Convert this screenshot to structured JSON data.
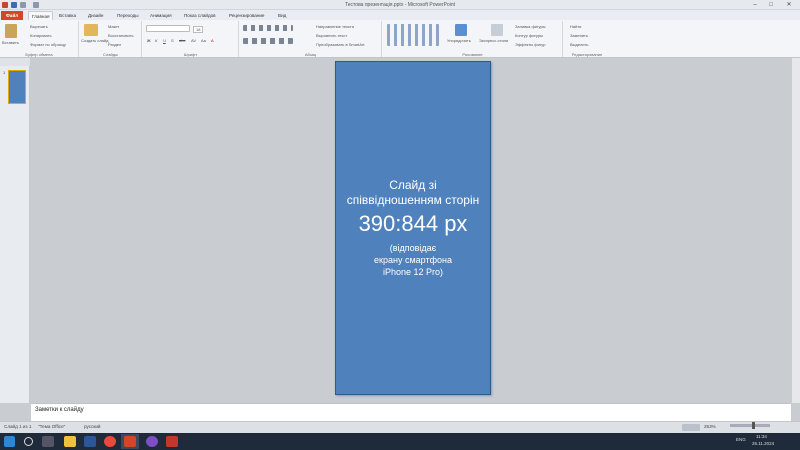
{
  "window": {
    "title": "Тестова презентація.pptx - Microsoft PowerPoint",
    "minimize": "–",
    "maximize": "□",
    "close": "✕"
  },
  "tabs": [
    "Файл",
    "Главная",
    "Вставка",
    "Дизайн",
    "Переходы",
    "Анимация",
    "Показ слайдов",
    "Рецензирование",
    "Вид"
  ],
  "ribbon": {
    "clipboard": {
      "label": "Буфер обмена",
      "paste": "Вставить",
      "cut": "Вырезать",
      "copy": "Копировать",
      "format": "Формат по образцу"
    },
    "slides": {
      "label": "Слайды",
      "new_slide": "Создать слайд",
      "layout": "Макет",
      "reset": "Восстановить",
      "section": "Раздел"
    },
    "font": {
      "label": "Шрифт",
      "size": "18",
      "buttons": [
        "Ж",
        "К",
        "Ч",
        "S",
        "abc",
        "AV",
        "Aa",
        "A"
      ]
    },
    "paragraph": {
      "label": "Абзац",
      "direction": "Направление текста",
      "align": "Выровнять текст",
      "smartart": "Преобразовать в SmartArt"
    },
    "drawing": {
      "label": "Рисование",
      "arrange": "Упорядочить",
      "quick_styles": "Экспресс-стили",
      "fill": "Заливка фигуры",
      "outline": "Контур фигуры",
      "effects": "Эффекты фигур"
    },
    "editing": {
      "label": "Редактирование",
      "find": "Найти",
      "replace": "Заменить",
      "select": "Выделить"
    }
  },
  "thumbnail": {
    "number": "1"
  },
  "slide": {
    "line1": "Слайд зі",
    "line2": "співвідношенням сторін",
    "ratio": "390:844 px",
    "note1": "(відповідає",
    "note2": "екрану смартфона",
    "note3": "iPhone 12 Pro)"
  },
  "notes": {
    "placeholder": "Заметки к слайду"
  },
  "status": {
    "slide": "Слайд 1 из 1",
    "theme": "\"Тема Office\"",
    "lang": "русский",
    "zoom": "253%"
  },
  "taskbar": {
    "lang": "ENG",
    "time": "11:34",
    "date": "26.11.2024"
  },
  "colors": {
    "slide_bg": "#4f81bd",
    "file_tab": "#d24726",
    "taskbar": "#1f2a3a"
  },
  "icons": [
    "windows-start-icon",
    "search-icon",
    "task-view-icon",
    "file-explorer-icon",
    "word-icon",
    "chrome-icon",
    "powerpoint-icon",
    "viber-icon",
    "app-icon"
  ]
}
